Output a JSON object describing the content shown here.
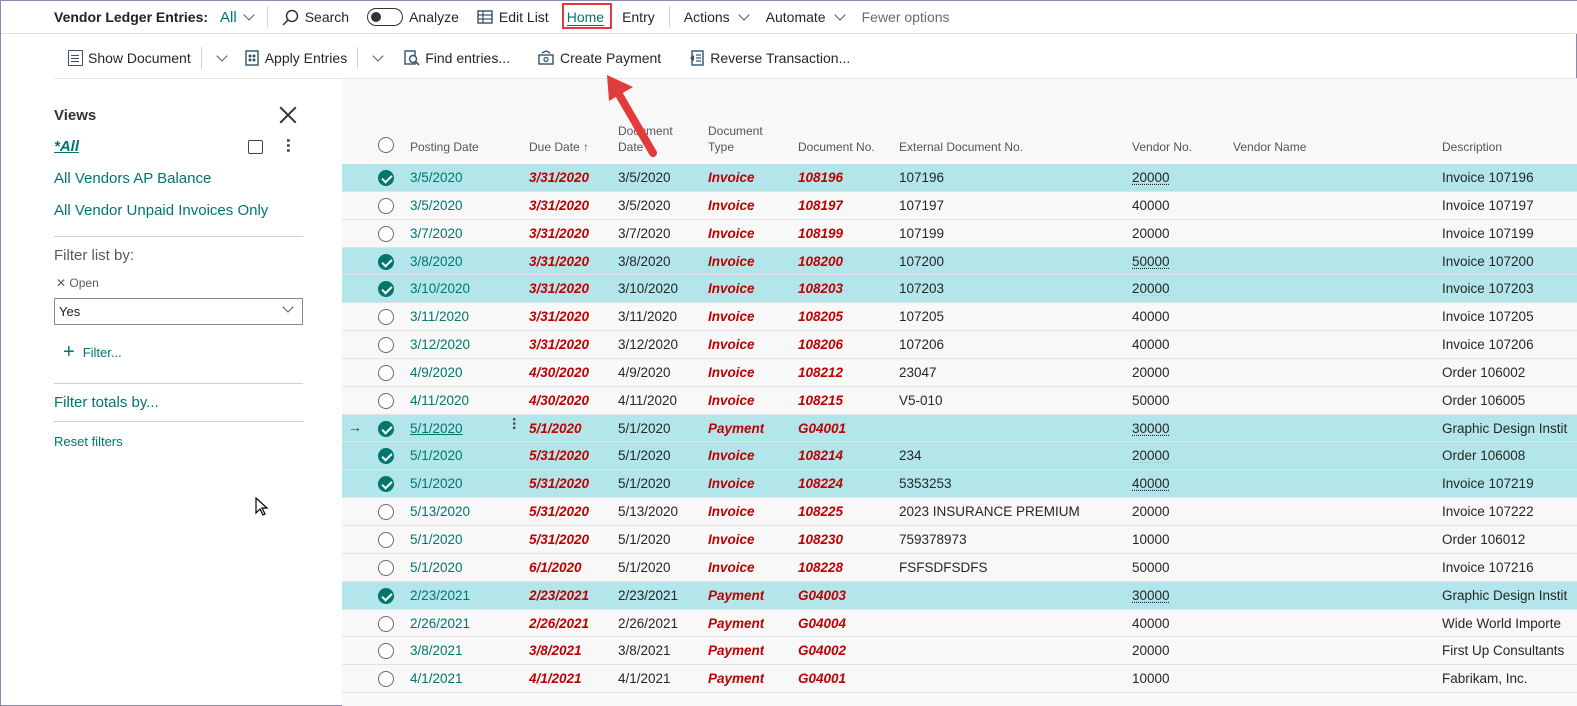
{
  "cmdbar": {
    "page_title": "Vendor Ledger Entries:",
    "view": "All",
    "search": "Search",
    "analyze": "Analyze",
    "edit_list": "Edit List",
    "home": "Home",
    "entry": "Entry",
    "actions": "Actions",
    "automate": "Automate",
    "fewer_options": "Fewer options"
  },
  "actionbar": {
    "show_document": "Show Document",
    "apply_entries": "Apply Entries",
    "find_entries": "Find entries...",
    "create_payment": "Create Payment",
    "reverse_transaction": "Reverse Transaction..."
  },
  "views": {
    "title": "Views",
    "current": "*All",
    "items": [
      "All Vendors AP Balance",
      "All Vendor Unpaid Invoices Only"
    ],
    "filter_list_by": "Filter list by:",
    "filter_field": "Open",
    "filter_value": "Yes",
    "add_filter": "Filter...",
    "filter_totals_by": "Filter totals by...",
    "reset_filters": "Reset filters"
  },
  "table": {
    "columns": {
      "posting_date": "Posting Date",
      "due_date": "Due Date",
      "document_date_1": "Document",
      "document_date_2": "Date",
      "document_type_1": "Document",
      "document_type_2": "Type",
      "document_no": "Document No.",
      "external_document_no": "External Document No.",
      "vendor_no": "Vendor No.",
      "vendor_name": "Vendor Name",
      "description": "Description"
    },
    "rows": [
      {
        "sel": true,
        "posting": "3/5/2020",
        "due": "3/31/2020",
        "ddate": "3/5/2020",
        "type": "Invoice",
        "no": "108196",
        "ext": "107196",
        "vendor": "20000",
        "desc": "Invoice 107196"
      },
      {
        "sel": false,
        "posting": "3/5/2020",
        "due": "3/31/2020",
        "ddate": "3/5/2020",
        "type": "Invoice",
        "no": "108197",
        "ext": "107197",
        "vendor": "40000",
        "desc": "Invoice 107197"
      },
      {
        "sel": false,
        "posting": "3/7/2020",
        "due": "3/31/2020",
        "ddate": "3/7/2020",
        "type": "Invoice",
        "no": "108199",
        "ext": "107199",
        "vendor": "20000",
        "desc": "Invoice 107199"
      },
      {
        "sel": true,
        "posting": "3/8/2020",
        "due": "3/31/2020",
        "ddate": "3/8/2020",
        "type": "Invoice",
        "no": "108200",
        "ext": "107200",
        "vendor": "50000",
        "desc": "Invoice 107200"
      },
      {
        "sel": true,
        "posting": "3/10/2020",
        "due": "3/31/2020",
        "ddate": "3/10/2020",
        "type": "Invoice",
        "no": "108203",
        "ext": "107203",
        "vendor": "20000",
        "desc": "Invoice 107203"
      },
      {
        "sel": false,
        "posting": "3/11/2020",
        "due": "3/31/2020",
        "ddate": "3/11/2020",
        "type": "Invoice",
        "no": "108205",
        "ext": "107205",
        "vendor": "40000",
        "desc": "Invoice 107205"
      },
      {
        "sel": false,
        "posting": "3/12/2020",
        "due": "3/31/2020",
        "ddate": "3/12/2020",
        "type": "Invoice",
        "no": "108206",
        "ext": "107206",
        "vendor": "40000",
        "desc": "Invoice 107206"
      },
      {
        "sel": false,
        "posting": "4/9/2020",
        "due": "4/30/2020",
        "ddate": "4/9/2020",
        "type": "Invoice",
        "no": "108212",
        "ext": "23047",
        "vendor": "20000",
        "desc": "Order 106002"
      },
      {
        "sel": false,
        "posting": "4/11/2020",
        "due": "4/30/2020",
        "ddate": "4/11/2020",
        "type": "Invoice",
        "no": "108215",
        "ext": "V5-010",
        "vendor": "50000",
        "desc": "Order 106005"
      },
      {
        "sel": true,
        "current": true,
        "posting": "5/1/2020",
        "due": "5/1/2020",
        "ddate": "5/1/2020",
        "type": "Payment",
        "no": "G04001",
        "ext": "",
        "vendor": "30000",
        "desc": "Graphic Design Instit"
      },
      {
        "sel": true,
        "posting": "5/1/2020",
        "due": "5/31/2020",
        "ddate": "5/1/2020",
        "type": "Invoice",
        "no": "108214",
        "ext": "234",
        "vendor": "20000",
        "desc": "Order 106008"
      },
      {
        "sel": true,
        "posting": "5/1/2020",
        "due": "5/31/2020",
        "ddate": "5/1/2020",
        "type": "Invoice",
        "no": "108224",
        "ext": "5353253",
        "vendor": "40000",
        "desc": "Invoice 107219"
      },
      {
        "sel": false,
        "posting": "5/13/2020",
        "due": "5/31/2020",
        "ddate": "5/13/2020",
        "type": "Invoice",
        "no": "108225",
        "ext": "2023 INSURANCE PREMIUM",
        "vendor": "20000",
        "desc": "Invoice 107222"
      },
      {
        "sel": false,
        "posting": "5/1/2020",
        "due": "5/31/2020",
        "ddate": "5/1/2020",
        "type": "Invoice",
        "no": "108230",
        "ext": "759378973",
        "vendor": "10000",
        "desc": "Order 106012"
      },
      {
        "sel": false,
        "posting": "5/1/2020",
        "due": "6/1/2020",
        "ddate": "5/1/2020",
        "type": "Invoice",
        "no": "108228",
        "ext": "FSFSDFSDFS",
        "vendor": "50000",
        "desc": "Invoice 107216"
      },
      {
        "sel": true,
        "posting": "2/23/2021",
        "due": "2/23/2021",
        "ddate": "2/23/2021",
        "type": "Payment",
        "no": "G04003",
        "ext": "",
        "vendor": "30000",
        "desc": "Graphic Design Instit"
      },
      {
        "sel": false,
        "posting": "2/26/2021",
        "due": "2/26/2021",
        "ddate": "2/26/2021",
        "type": "Payment",
        "no": "G04004",
        "ext": "",
        "vendor": "40000",
        "desc": "Wide World Importe"
      },
      {
        "sel": false,
        "posting": "3/8/2021",
        "due": "3/8/2021",
        "ddate": "3/8/2021",
        "type": "Payment",
        "no": "G04002",
        "ext": "",
        "vendor": "20000",
        "desc": "First Up Consultants"
      },
      {
        "sel": false,
        "posting": "4/1/2021",
        "due": "4/1/2021",
        "ddate": "4/1/2021",
        "type": "Payment",
        "no": "G04001",
        "ext": "",
        "vendor": "10000",
        "desc": "Fabrikam, Inc."
      }
    ]
  },
  "colors": {
    "accent": "#00766c",
    "selected_row": "#b2e6ea",
    "overdue_text": "#c00000",
    "annotation": "#e23b3b"
  }
}
